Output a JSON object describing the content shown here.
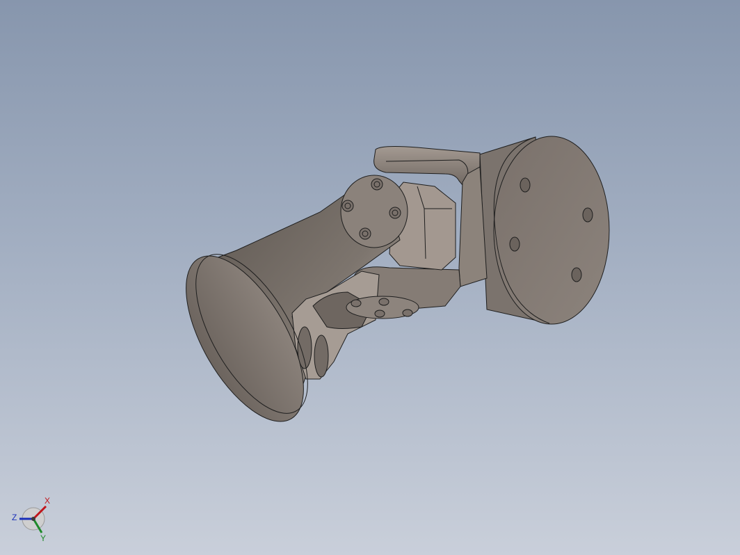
{
  "viewport": {
    "background_top": "#8796ad",
    "background_bottom": "#c9cfda"
  },
  "model": {
    "part_color": "#8a817a",
    "part_shadow": "#5e5650",
    "part_highlight": "#b3aaa2",
    "edge_color": "#1e1e1e"
  },
  "triad": {
    "x_label": "X",
    "y_label": "Y",
    "z_label": "Z",
    "x_color": "#c0141a",
    "y_color": "#1f8a2a",
    "z_color": "#1a2fb8"
  }
}
